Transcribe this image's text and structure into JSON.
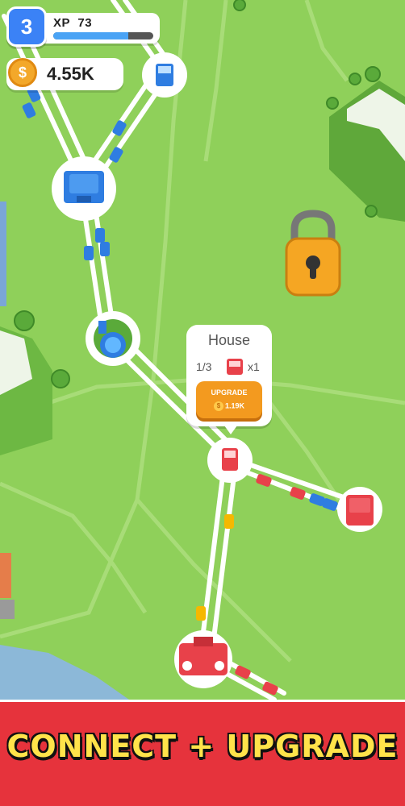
{
  "hud": {
    "level": "3",
    "xp_label": "XP",
    "xp_value": "73",
    "xp_progress": 0.75,
    "coins": "4.55K"
  },
  "popup": {
    "title": "House",
    "count": "1/3",
    "multiplier": "x1",
    "upgrade_label": "UPGRADE",
    "upgrade_cost": "1.19K"
  },
  "banner": {
    "text": "CONNECT + UPGRADE"
  },
  "colors": {
    "grass": "#8fd05a",
    "road": "#ffffff",
    "blue_team": "#2f7de1",
    "red_team": "#e8414a",
    "banner_bg": "#e6333c",
    "banner_text": "#ffe34a",
    "upgrade_button": "#f39a1f",
    "lock": "#f5a623"
  },
  "icons": [
    "level-badge",
    "coin-icon",
    "lock-icon",
    "house-icon",
    "van-icon",
    "fountain-icon",
    "tree-icon",
    "car-icon"
  ]
}
